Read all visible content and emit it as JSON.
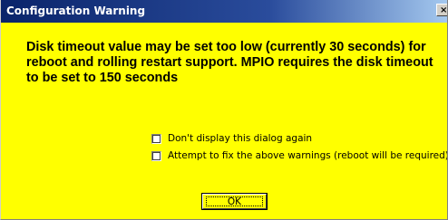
{
  "window": {
    "title": "Configuration Warning",
    "close_glyph": "×"
  },
  "message": "Disk timeout value may be set too low (currently 30 seconds) for reboot and rolling restart support. MPIO requires the disk timeout to be set to 150 seconds",
  "options": [
    {
      "label": "Don't display this dialog again",
      "checked": false
    },
    {
      "label": "Attempt to fix the above warnings (reboot will be required)",
      "checked": false
    }
  ],
  "buttons": {
    "ok_label": "OK"
  },
  "colors": {
    "title_bar": "#0a246a",
    "background": "#ffff00",
    "text": "#000000"
  }
}
